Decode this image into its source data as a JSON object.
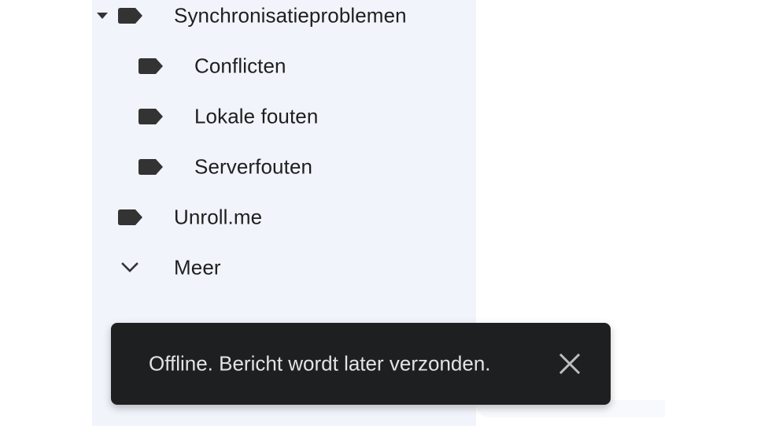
{
  "sidebar": {
    "items": [
      {
        "label": "Synchronisatieproblemen",
        "icon": "label-icon",
        "expander": "caret-down-icon"
      },
      {
        "label": "Conflicten",
        "icon": "label-icon"
      },
      {
        "label": "Lokale fouten",
        "icon": "label-icon"
      },
      {
        "label": "Serverfouten",
        "icon": "label-icon"
      },
      {
        "label": "Unroll.me",
        "icon": "label-icon"
      },
      {
        "label": "Meer",
        "icon": "chevron-down-icon"
      }
    ]
  },
  "snackbar": {
    "message": "Offline. Bericht wordt later verzonden.",
    "close_icon": "close-icon"
  },
  "colors": {
    "sidebar_background": "#f1f4fb",
    "text": "#1f1f1f",
    "icon": "#333333",
    "snackbar_background": "#1e1f20",
    "snackbar_text": "#e3e3e3"
  }
}
